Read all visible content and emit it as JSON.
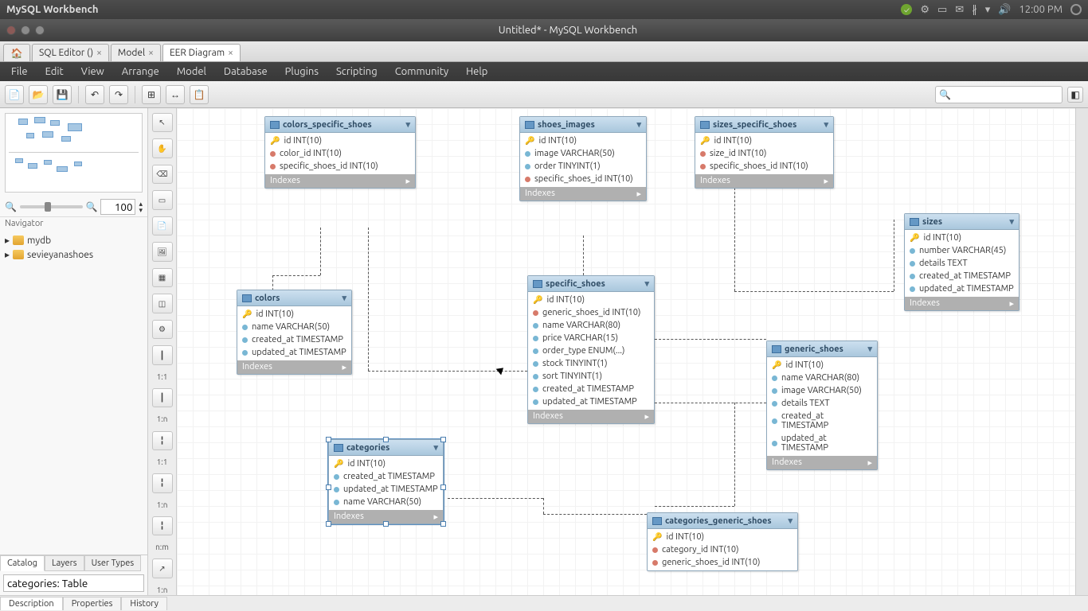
{
  "os": {
    "title": "MySQL Workbench",
    "time": "12:00 PM"
  },
  "window": {
    "title": "Untitled* - MySQL Workbench"
  },
  "tabs": [
    {
      "label": "SQL Editor ()",
      "closable": true
    },
    {
      "label": "Model",
      "closable": true
    },
    {
      "label": "EER Diagram",
      "closable": true,
      "active": true
    }
  ],
  "menu": [
    "File",
    "Edit",
    "View",
    "Arrange",
    "Model",
    "Database",
    "Plugins",
    "Scripting",
    "Community",
    "Help"
  ],
  "zoom": "100",
  "navigator_label": "Navigator",
  "schemas": [
    "mydb",
    "sevieyanashoes"
  ],
  "catalog_tabs": [
    "Catalog",
    "Layers",
    "User Types"
  ],
  "catalog_field": "categories: Table",
  "tool_labels": [
    "1:1",
    "1:n",
    "1:1",
    "1:n",
    "n:m",
    "1:n"
  ],
  "search_placeholder": "",
  "bottom_tabs": [
    "Description",
    "Properties",
    "History"
  ],
  "indexes_label": "Indexes",
  "entities": {
    "colors_specific_shoes": {
      "title": "colors_specific_shoes",
      "cols": [
        {
          "k": "pk",
          "t": "id INT(10)"
        },
        {
          "k": "fk",
          "t": "color_id INT(10)"
        },
        {
          "k": "fk",
          "t": "specific_shoes_id INT(10)"
        }
      ]
    },
    "shoes_images": {
      "title": "shoes_images",
      "cols": [
        {
          "k": "pk",
          "t": "id INT(10)"
        },
        {
          "k": "a",
          "t": "image VARCHAR(50)"
        },
        {
          "k": "a",
          "t": "order TINYINT(1)"
        },
        {
          "k": "fk",
          "t": "specific_shoes_id INT(10)"
        }
      ]
    },
    "sizes_specific_shoes": {
      "title": "sizes_specific_shoes",
      "cols": [
        {
          "k": "pk",
          "t": "id INT(10)"
        },
        {
          "k": "fk",
          "t": "size_id INT(10)"
        },
        {
          "k": "fk",
          "t": "specific_shoes_id INT(10)"
        }
      ]
    },
    "sizes": {
      "title": "sizes",
      "cols": [
        {
          "k": "pk",
          "t": "id INT(10)"
        },
        {
          "k": "a",
          "t": "number VARCHAR(45)"
        },
        {
          "k": "a",
          "t": "details TEXT"
        },
        {
          "k": "a",
          "t": "created_at TIMESTAMP"
        },
        {
          "k": "a",
          "t": "updated_at TIMESTAMP"
        }
      ]
    },
    "colors": {
      "title": "colors",
      "cols": [
        {
          "k": "pk",
          "t": "id INT(10)"
        },
        {
          "k": "a",
          "t": "name VARCHAR(50)"
        },
        {
          "k": "a",
          "t": "created_at TIMESTAMP"
        },
        {
          "k": "a",
          "t": "updated_at TIMESTAMP"
        }
      ]
    },
    "specific_shoes": {
      "title": "specific_shoes",
      "cols": [
        {
          "k": "pk",
          "t": "id INT(10)"
        },
        {
          "k": "fk",
          "t": "generic_shoes_id INT(10)"
        },
        {
          "k": "a",
          "t": "name VARCHAR(80)"
        },
        {
          "k": "a",
          "t": "price VARCHAR(15)"
        },
        {
          "k": "a",
          "t": "order_type ENUM(...)"
        },
        {
          "k": "a",
          "t": "stock TINYINT(1)"
        },
        {
          "k": "a",
          "t": "sort TINYINT(1)"
        },
        {
          "k": "a",
          "t": "created_at TIMESTAMP"
        },
        {
          "k": "a",
          "t": "updated_at TIMESTAMP"
        }
      ]
    },
    "generic_shoes": {
      "title": "generic_shoes",
      "cols": [
        {
          "k": "pk",
          "t": "id INT(10)"
        },
        {
          "k": "a",
          "t": "name VARCHAR(80)"
        },
        {
          "k": "a",
          "t": "image VARCHAR(50)"
        },
        {
          "k": "a",
          "t": "details TEXT"
        },
        {
          "k": "a",
          "t": "created_at TIMESTAMP"
        },
        {
          "k": "a",
          "t": "updated_at TIMESTAMP"
        }
      ]
    },
    "categories": {
      "title": "categories",
      "cols": [
        {
          "k": "pk",
          "t": "id INT(10)"
        },
        {
          "k": "a",
          "t": "created_at TIMESTAMP"
        },
        {
          "k": "a",
          "t": "updated_at TIMESTAMP"
        },
        {
          "k": "a",
          "t": "name VARCHAR(50)"
        }
      ]
    },
    "categories_generic_shoes": {
      "title": "categories_generic_shoes",
      "cols": [
        {
          "k": "pk",
          "t": "id INT(10)"
        },
        {
          "k": "fk",
          "t": "category_id INT(10)"
        },
        {
          "k": "fk",
          "t": "generic_shoes_id INT(10)"
        }
      ]
    }
  }
}
